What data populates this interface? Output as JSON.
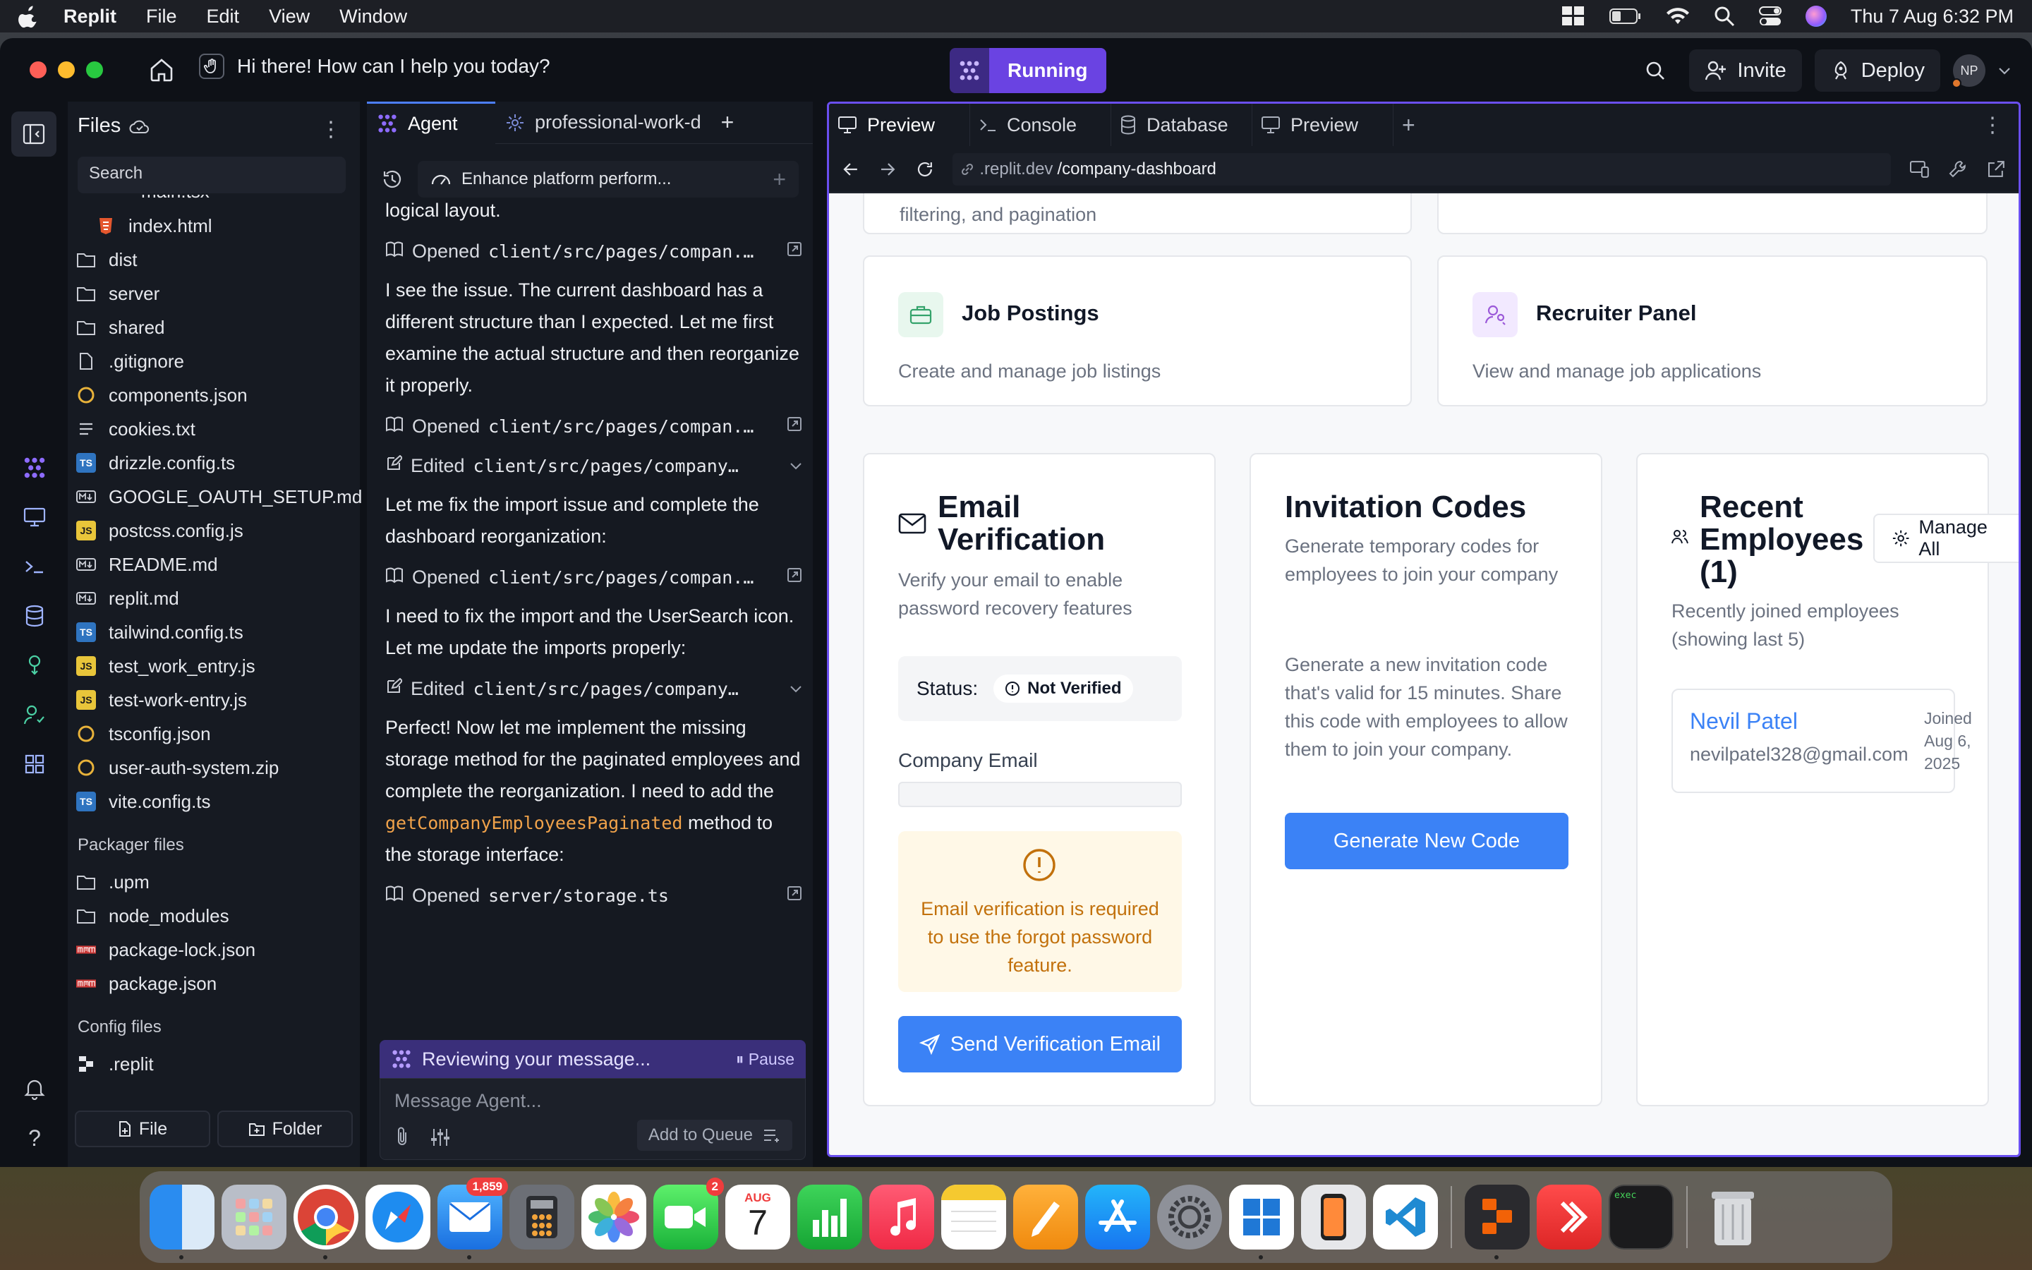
{
  "menubar": {
    "app": "Replit",
    "items": [
      "File",
      "Edit",
      "View",
      "Window"
    ],
    "datetime": "Thu 7 Aug  6:32 PM"
  },
  "titlebar": {
    "prompt": "Hi there! How can I help you today?",
    "run_label": "Running",
    "invite": "Invite",
    "deploy": "Deploy",
    "avatar": "NP"
  },
  "files": {
    "title": "Files",
    "search_placeholder": "Search",
    "partial_item": "main.tsx",
    "items": [
      {
        "name": "index.html",
        "icon": "html-icon",
        "indent": true
      },
      {
        "name": "dist",
        "icon": "folder-icon"
      },
      {
        "name": "server",
        "icon": "folder-icon"
      },
      {
        "name": "shared",
        "icon": "folder-icon"
      },
      {
        "name": ".gitignore",
        "icon": "file-icon"
      },
      {
        "name": "components.json",
        "icon": "json-icon"
      },
      {
        "name": "cookies.txt",
        "icon": "text-icon"
      },
      {
        "name": "drizzle.config.ts",
        "icon": "ts-icon"
      },
      {
        "name": "GOOGLE_OAUTH_SETUP.md",
        "icon": "md-icon"
      },
      {
        "name": "postcss.config.js",
        "icon": "js-icon"
      },
      {
        "name": "README.md",
        "icon": "md-icon"
      },
      {
        "name": "replit.md",
        "icon": "md-icon"
      },
      {
        "name": "tailwind.config.ts",
        "icon": "ts-icon"
      },
      {
        "name": "test_work_entry.js",
        "icon": "js-icon"
      },
      {
        "name": "test-work-entry.js",
        "icon": "js-icon"
      },
      {
        "name": "tsconfig.json",
        "icon": "json-icon"
      },
      {
        "name": "user-auth-system.zip",
        "icon": "zip-icon"
      },
      {
        "name": "vite.config.ts",
        "icon": "ts-icon"
      }
    ],
    "packager_label": "Packager files",
    "packager_items": [
      {
        "name": ".upm",
        "icon": "folder-icon"
      },
      {
        "name": "node_modules",
        "icon": "folder-icon"
      },
      {
        "name": "package-lock.json",
        "icon": "npm-icon"
      },
      {
        "name": "package.json",
        "icon": "npm-icon"
      }
    ],
    "config_label": "Config files",
    "config_items": [
      {
        "name": ".replit",
        "icon": "replit-icon"
      }
    ],
    "new_file": "File",
    "new_folder": "Folder"
  },
  "agent": {
    "tab_agent": "Agent",
    "tab_project": "professional-work-d",
    "task": "Enhance platform perform...",
    "feed": [
      {
        "type": "msg",
        "text": "logical layout."
      },
      {
        "type": "act",
        "verb": "Opened",
        "path": "client/src/pages/compan..."
      },
      {
        "type": "msg",
        "text": "I see the issue. The current dashboard has a different structure than I expected. Let me first examine the actual structure and then reorganize it properly."
      },
      {
        "type": "act",
        "verb": "Opened",
        "path": "client/src/pages/compan..."
      },
      {
        "type": "edit",
        "verb": "Edited",
        "path": "client/src/pages/company..."
      },
      {
        "type": "msg",
        "text": "Let me fix the import issue and complete the dashboard reorganization:"
      },
      {
        "type": "act",
        "verb": "Opened",
        "path": "client/src/pages/compan..."
      },
      {
        "type": "msg",
        "text": "I need to fix the import and the UserSearch icon. Let me update the imports properly:"
      },
      {
        "type": "edit",
        "verb": "Edited",
        "path": "client/src/pages/company..."
      }
    ],
    "final_msg_a": "Perfect! Now let me implement the missing storage method for the paginated employees and complete the reorganization. I need to add the ",
    "final_msg_code": "getCompanyEmployeesPaginated",
    "final_msg_b": "method to the storage interface:",
    "last_act_verb": "Opened",
    "last_act_path": "server/storage.ts",
    "reviewing": "Reviewing your message...",
    "pause": "Pause",
    "placeholder": "Message Agent...",
    "queue": "Add to Queue"
  },
  "preview": {
    "tabs": [
      "Preview",
      "Console",
      "Database",
      "Preview"
    ],
    "url_prefix": ".replit.dev",
    "url_path": "/company-dashboard",
    "partial_text": "filtering, and pagination",
    "job_title": "Job Postings",
    "job_sub": "Create and manage job listings",
    "rec_title": "Recruiter Panel",
    "rec_sub": "View and manage job applications",
    "email": {
      "title_1": "Email",
      "title_2": "Verification",
      "sub": "Verify your email to enable password recovery features",
      "status_label": "Status:",
      "status_value": "Not Verified",
      "field_label": "Company Email",
      "warning": "Email verification is required to use the forgot password feature.",
      "button": "Send Verification Email"
    },
    "invite": {
      "title": "Invitation Codes",
      "sub": "Generate temporary codes for employees to join your company",
      "body": "Generate a new invitation code that's valid for 15 minutes. Share this code with employees to allow them to join your company.",
      "button": "Generate New Code"
    },
    "recent": {
      "title_1": "Recent",
      "title_2": "Employees",
      "title_3": "(1)",
      "manage": "Manage All",
      "sub": "Recently joined employees (showing last 5)",
      "emp_name": "Nevil Patel",
      "emp_email": "nevilpatel328@gmail.com",
      "joined_1": "Joined",
      "joined_2": "Aug 6,",
      "joined_3": "2025"
    }
  },
  "dock": {
    "mail_badge": "1,859",
    "facetime_badge": "2",
    "cal_month": "AUG",
    "cal_day": "7"
  }
}
